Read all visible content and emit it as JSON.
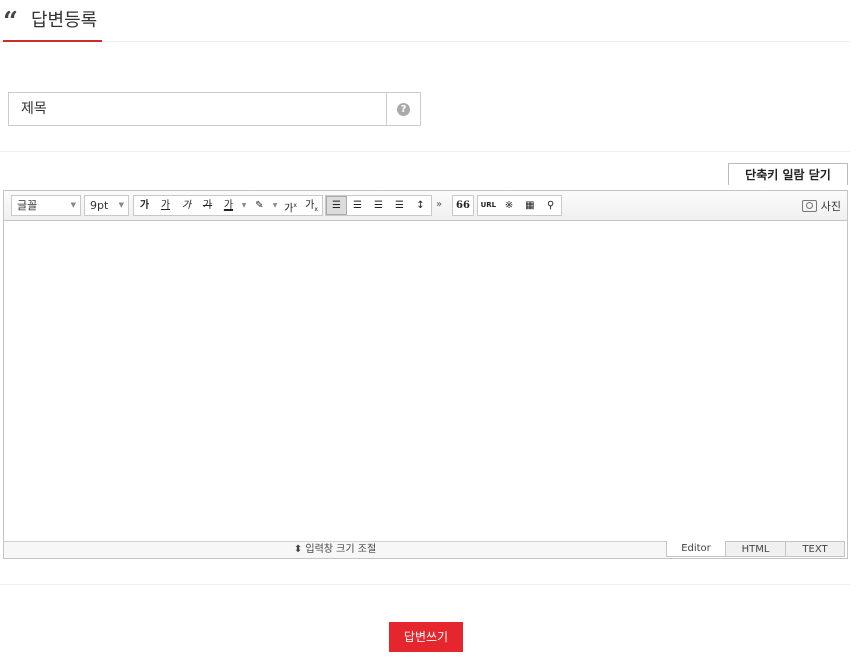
{
  "header": {
    "title": "답변등록",
    "icon": "quote-icon",
    "accent": "#c9302c"
  },
  "subject": {
    "placeholder": "제목",
    "value": ""
  },
  "shortcut_label": "단축키 일람 닫기",
  "toolbar": {
    "font_family": "글꼴",
    "font_size": "9pt",
    "format_buttons": [
      "가",
      "가",
      "가",
      "가",
      "가"
    ],
    "superscript": "가",
    "subscript": "가",
    "more": "»",
    "quote": "66",
    "url": "URL",
    "photo_label": "사진"
  },
  "footer": {
    "resize_label": "입력창 크기 조절",
    "modes": [
      "Editor",
      "HTML",
      "TEXT"
    ]
  },
  "submit_label": "답변쓰기",
  "colors": {
    "submit": "#e5262d"
  }
}
